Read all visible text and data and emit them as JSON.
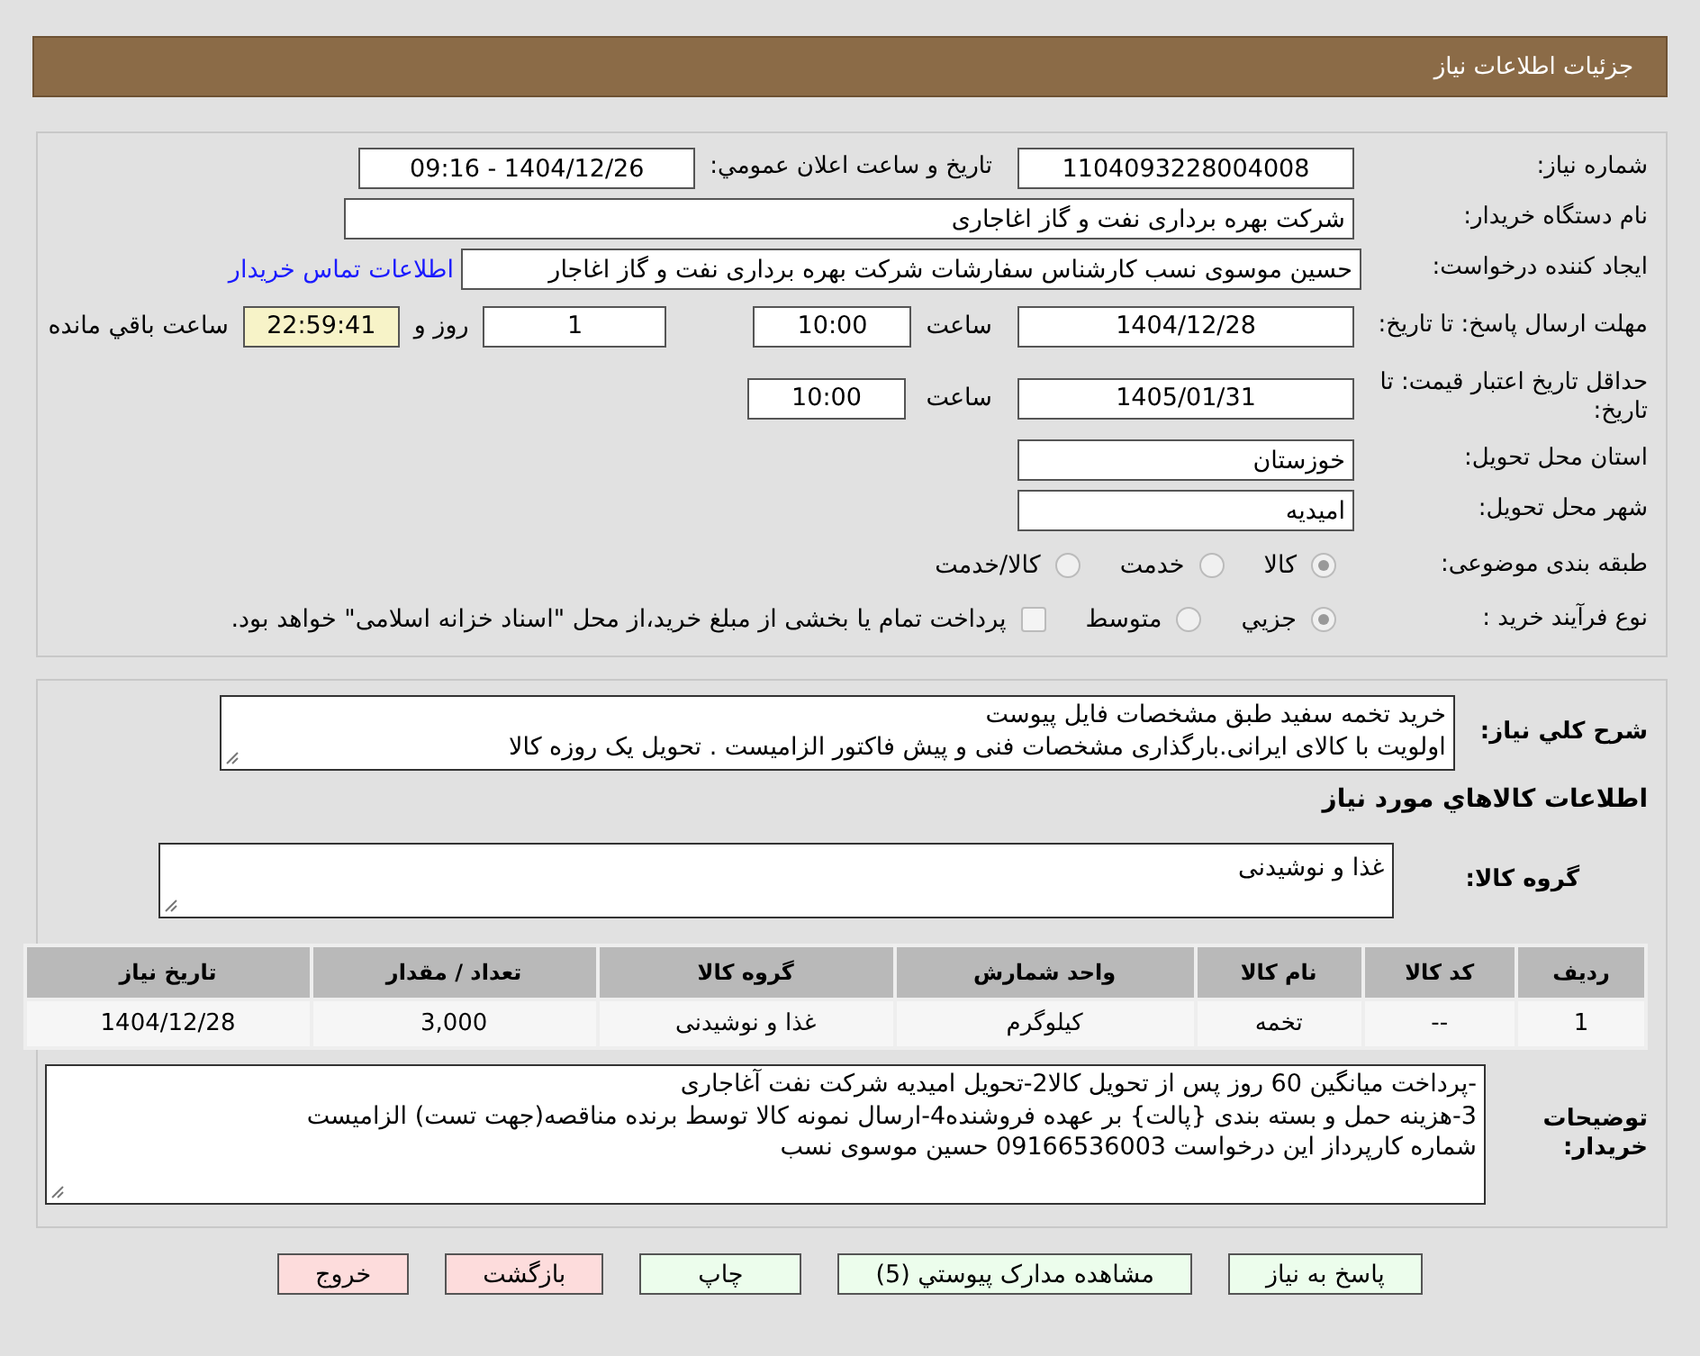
{
  "header": {
    "title": "جزئیات اطلاعات نیاز"
  },
  "need_number": {
    "label": "شماره نیاز:",
    "value": "1104093228004008"
  },
  "announce": {
    "label": "تاریخ و ساعت اعلان عمومي:",
    "value": "1404/12/26 - 09:16"
  },
  "buyer_org": {
    "label": "نام دستگاه خریدار:",
    "value": "شرکت بهره برداری نفت و گاز اغاجاری"
  },
  "requester": {
    "label": "ایجاد کننده درخواست:",
    "value": "حسین موسوی نسب کارشناس سفارشات شرکت بهره برداری نفت و گاز اغاجار",
    "link": "اطلاعات تماس خریدار"
  },
  "reply_deadline": {
    "label": "مهلت ارسال پاسخ: تا تاریخ:",
    "date": "1404/12/28",
    "time_label": "ساعت",
    "time": "10:00",
    "days": "1",
    "days_label": "روز و",
    "remaining": "22:59:41",
    "remaining_label": "ساعت باقي مانده"
  },
  "price_validity": {
    "label": "حداقل تاریخ اعتبار قیمت: تا تاریخ:",
    "date": "1405/01/31",
    "time_label": "ساعت",
    "time": "10:00"
  },
  "province": {
    "label": "استان محل تحویل:",
    "value": "خوزستان"
  },
  "city": {
    "label": "شهر محل تحویل:",
    "value": "امیدیه"
  },
  "category": {
    "label": "طبقه بندی موضوعی:",
    "options": [
      {
        "label": "کالا",
        "selected": true
      },
      {
        "label": "خدمت",
        "selected": false
      },
      {
        "label": "کالا/خدمت",
        "selected": false
      }
    ]
  },
  "process": {
    "label": "نوع فرآیند خرید :",
    "options": [
      {
        "label": "جزيي",
        "selected": true
      },
      {
        "label": "متوسط",
        "selected": false
      }
    ],
    "treasury": {
      "label": "پرداخت تمام یا بخشی از مبلغ خرید،از محل \"اسناد خزانه اسلامی\" خواهد بود.",
      "checked": false
    }
  },
  "description": {
    "label": "شرح کلي نیاز:",
    "lines": [
      "خرید تخمه سفید  طبق  مشخصات فایل پیوست",
      "اولویت با کالای ایرانی.بارگذاری مشخصات فنی و پیش فاکتور الزامیست . تحویل یک روزه کالا"
    ]
  },
  "goods_title": "اطلاعات کالاهاي مورد نیاز",
  "goods_group": {
    "label": "گروه کالا:",
    "value": "غذا و نوشیدنی"
  },
  "table": {
    "columns": [
      "ردیف",
      "کد کالا",
      "نام کالا",
      "واحد شمارش",
      "گروه کالا",
      "تعداد / مقدار",
      "تاریخ نیاز"
    ],
    "rows": [
      [
        "1",
        "--",
        "تخمه",
        "کیلوگرم",
        "غذا و نوشیدنی",
        "3,000",
        "1404/12/28"
      ]
    ]
  },
  "buyer_notes": {
    "label": "توضیحات خریدار:",
    "lines": [
      "-پرداخت میانگین 60 روز پس از تحویل کالا2-تحویل امیدیه شرکت نفت آغاجاری",
      "3-هزینه حمل  و بسته بندی {پالت} بر عهده فروشنده4-ارسال نمونه کالا توسط برنده مناقصه(جهت تست) الزامیست",
      "شماره کارپرداز این درخواست 09166536003 حسین موسوی نسب"
    ]
  },
  "buttons": [
    {
      "label": "پاسخ به نیاز",
      "kind": "action"
    },
    {
      "label": "مشاهده مدارک پیوستي (5)",
      "kind": "action"
    },
    {
      "label": "چاپ",
      "kind": "action"
    },
    {
      "label": "بازگشت",
      "kind": "exit"
    },
    {
      "label": "خروج",
      "kind": "exit"
    }
  ]
}
